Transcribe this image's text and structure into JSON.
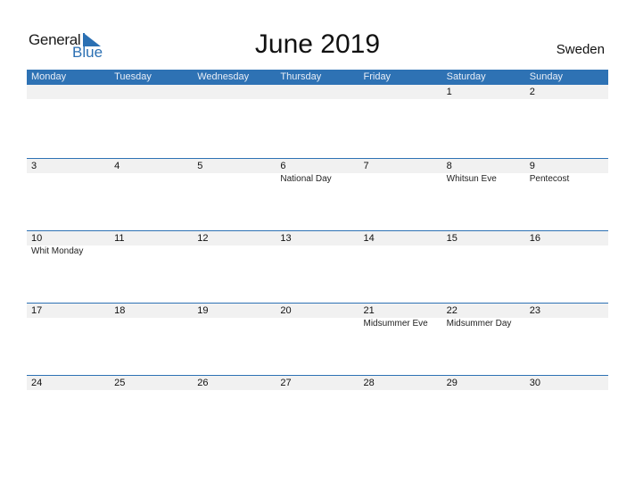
{
  "logo": {
    "general": "General",
    "blue": "Blue"
  },
  "title": "June 2019",
  "country": "Sweden",
  "colors": {
    "accent": "#2e72b4",
    "band": "#f1f1f1"
  },
  "days_of_week": [
    "Monday",
    "Tuesday",
    "Wednesday",
    "Thursday",
    "Friday",
    "Saturday",
    "Sunday"
  ],
  "weeks": [
    {
      "days": [
        "",
        "",
        "",
        "",
        "",
        "1",
        "2"
      ],
      "holidays": [
        "",
        "",
        "",
        "",
        "",
        "",
        ""
      ]
    },
    {
      "days": [
        "3",
        "4",
        "5",
        "6",
        "7",
        "8",
        "9"
      ],
      "holidays": [
        "",
        "",
        "",
        "National Day",
        "",
        "Whitsun Eve",
        "Pentecost"
      ]
    },
    {
      "days": [
        "10",
        "11",
        "12",
        "13",
        "14",
        "15",
        "16"
      ],
      "holidays": [
        "Whit Monday",
        "",
        "",
        "",
        "",
        "",
        ""
      ]
    },
    {
      "days": [
        "17",
        "18",
        "19",
        "20",
        "21",
        "22",
        "23"
      ],
      "holidays": [
        "",
        "",
        "",
        "",
        "Midsummer Eve",
        "Midsummer Day",
        ""
      ]
    },
    {
      "days": [
        "24",
        "25",
        "26",
        "27",
        "28",
        "29",
        "30"
      ],
      "holidays": [
        "",
        "",
        "",
        "",
        "",
        "",
        ""
      ]
    }
  ]
}
